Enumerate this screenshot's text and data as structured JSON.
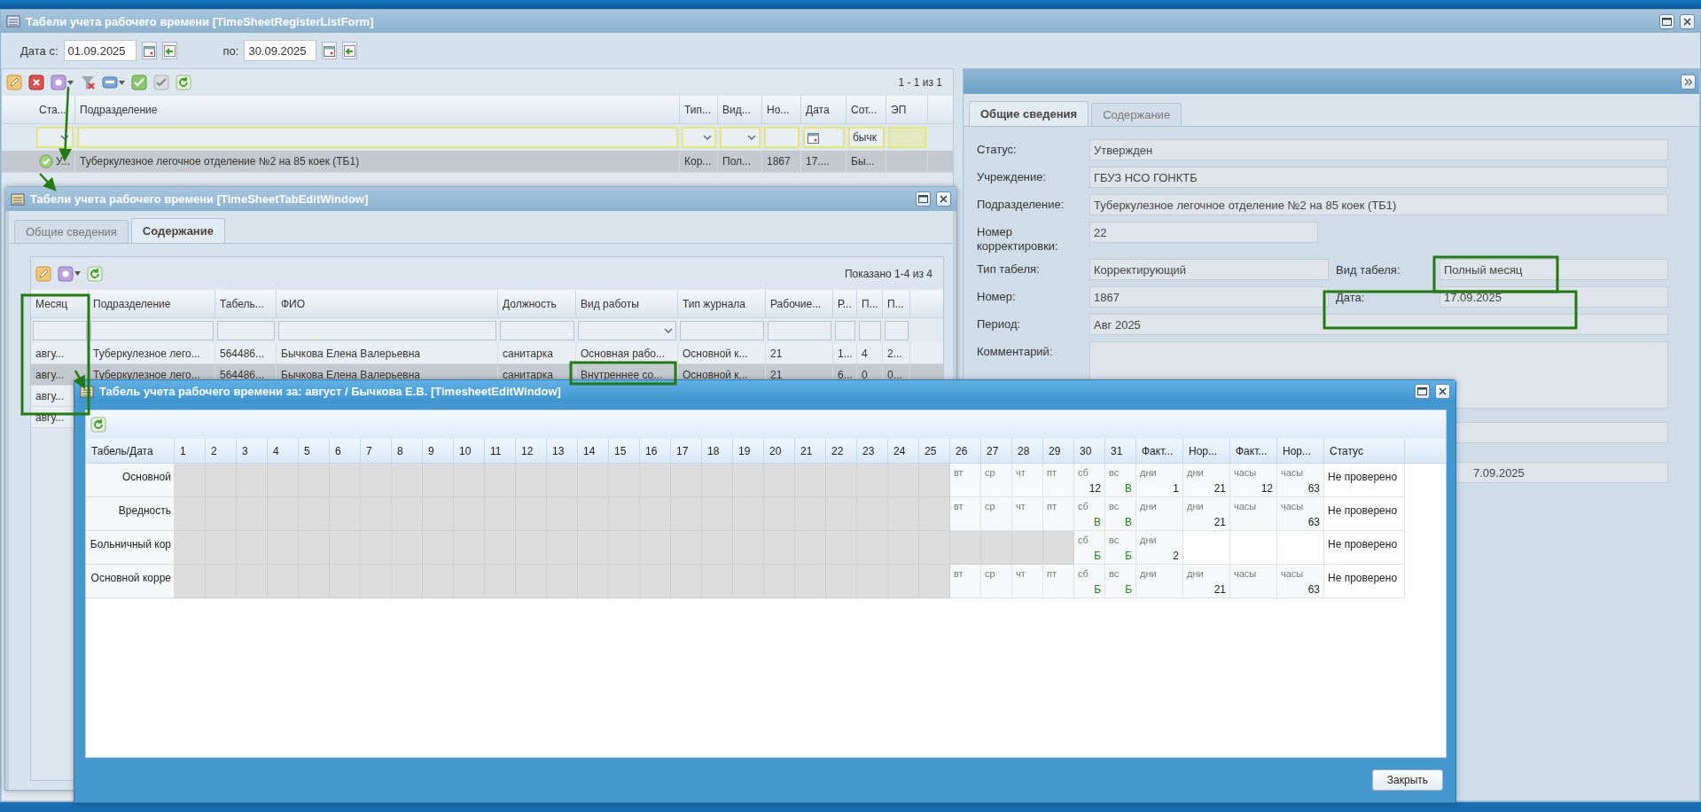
{
  "list_window": {
    "title": "Табели учета рабочего времени [TimeSheetRegisterListForm]",
    "date_from_label": "Дата с:",
    "date_from": "01.09.2025",
    "date_to_label": "по:",
    "date_to": "30.09.2025",
    "pager": "1 - 1 из 1",
    "columns": [
      "Ста...",
      "Подразделение",
      "Тип...",
      "Вид...",
      "Но...",
      "Дата",
      "Сот...",
      "ЭП"
    ],
    "filters": [
      {
        "kind": "select"
      },
      {
        "kind": "text"
      },
      {
        "kind": "select"
      },
      {
        "kind": "select"
      },
      {
        "kind": "text"
      },
      {
        "kind": "date"
      },
      {
        "kind": "text",
        "value": "бычк"
      },
      {
        "kind": "flag"
      }
    ],
    "rows": [
      {
        "selected": true,
        "cells": [
          "У...",
          "Туберкулезное легочное отделение №2 на 85 коек (ТБ1)",
          "Кор...",
          "Пол...",
          "1867",
          "17....",
          "Бы...",
          ""
        ]
      }
    ]
  },
  "detail_panel": {
    "tabs": [
      {
        "label": "Общие сведения",
        "selected": true
      },
      {
        "label": "Содержание",
        "selected": false
      }
    ],
    "fields": [
      {
        "kind": "single",
        "label": "Статус:",
        "value": "Утвержден"
      },
      {
        "kind": "single",
        "label": "Учреждение:",
        "value": "ГБУЗ НСО ГОНКТБ"
      },
      {
        "kind": "single",
        "label": "Подразделение:",
        "value": "Туберкулезное легочное отделение №2 на 85 коек (ТБ1)"
      },
      {
        "kind": "short",
        "label": "Номер корректировки:",
        "value": "22"
      },
      {
        "kind": "pair",
        "label": "Тип табеля:",
        "value": "Корректирующий",
        "side_label": "Вид табеля:",
        "side_value": "Полный месяц"
      },
      {
        "kind": "pair",
        "label": "Номер:",
        "value": "1867",
        "side_label": "Дата:",
        "side_value": "17.09.2025"
      },
      {
        "kind": "single",
        "label": "Период:",
        "value": "Авг 2025"
      },
      {
        "kind": "area",
        "label": "Комментарий:"
      },
      {
        "kind": "covered"
      },
      {
        "kind": "covered",
        "value": "7.09.2025"
      }
    ]
  },
  "tab_window": {
    "title": "Табели учета рабочего времени [TimeSheetTabEditWindow]",
    "tabs": [
      {
        "label": "Общие сведения",
        "selected": false
      },
      {
        "label": "Содержание",
        "selected": true
      }
    ],
    "pager": "Показано 1-4 из 4",
    "columns": [
      "Месяц",
      "Подразделение",
      "Табель...",
      "ФИО",
      "Должность",
      "Вид работы",
      "Тип журнала",
      "Рабочие...",
      "Р...",
      "П...",
      "П..."
    ],
    "filters": [
      {
        "kind": "text"
      },
      {
        "kind": "text"
      },
      {
        "kind": "text"
      },
      {
        "kind": "text"
      },
      {
        "kind": "text"
      },
      {
        "kind": "select"
      },
      {
        "kind": "text"
      },
      {
        "kind": "text"
      },
      {
        "kind": "text"
      },
      {
        "kind": "text"
      },
      {
        "kind": "text"
      }
    ],
    "rows": [
      {
        "selected": false,
        "cells": [
          "авгу...",
          "Туберкулезное лего...",
          "564486...",
          "Бычкова Елена Валерьевна",
          "санитарка",
          "Основная рабо...",
          "Основной к...",
          "21",
          "1...",
          "4",
          "2..."
        ]
      },
      {
        "selected": true,
        "cells": [
          "авгу...",
          "Туберкулезное лего...",
          "564486...",
          "Бычкова Елена Валерьевна",
          "санитарка",
          "Внутреннее со...",
          "Основной к...",
          "21",
          "6...",
          "0",
          "0..."
        ]
      },
      {
        "selected": false,
        "cells": [
          "авгу..."
        ]
      },
      {
        "selected": false,
        "cells": [
          "авгу..."
        ]
      }
    ]
  },
  "sheet_window": {
    "title": "Табель учета рабочего времени за: август / Бычкова Е.В. [TimesheetEditWindow]",
    "close_button": "Закрыть",
    "columns": [
      "Табель/Дата",
      "1",
      "2",
      "3",
      "4",
      "5",
      "6",
      "7",
      "8",
      "9",
      "10",
      "11",
      "12",
      "13",
      "14",
      "15",
      "16",
      "17",
      "18",
      "19",
      "20",
      "21",
      "22",
      "23",
      "24",
      "25",
      "26",
      "27",
      "28",
      "29",
      "30",
      "31",
      "Факт...",
      "Нор...",
      "Факт...",
      "Нор...",
      "Статус"
    ],
    "rows": [
      {
        "label": "Основной",
        "status": "Не проверено",
        "days": [
          {
            "kind": "blank"
          },
          {
            "kind": "blank"
          },
          {
            "kind": "blank"
          },
          {
            "kind": "blank"
          },
          {
            "kind": "blank"
          },
          {
            "kind": "blank"
          },
          {
            "kind": "blank"
          },
          {
            "kind": "blank"
          },
          {
            "kind": "blank"
          },
          {
            "kind": "blank"
          },
          {
            "kind": "blank"
          },
          {
            "kind": "blank"
          },
          {
            "kind": "blank"
          },
          {
            "kind": "blank"
          },
          {
            "kind": "blank"
          },
          {
            "kind": "blank"
          },
          {
            "kind": "blank"
          },
          {
            "kind": "blank"
          },
          {
            "kind": "blank"
          },
          {
            "kind": "blank"
          },
          {
            "kind": "blank"
          },
          {
            "kind": "blank"
          },
          {
            "kind": "blank"
          },
          {
            "kind": "blank"
          },
          {
            "kind": "blank"
          },
          {
            "kind": "day",
            "weekday": "вт"
          },
          {
            "kind": "day",
            "weekday": "ср"
          },
          {
            "kind": "day",
            "weekday": "чт"
          },
          {
            "kind": "day",
            "weekday": "пт"
          },
          {
            "kind": "day",
            "weekday": "сб",
            "value": "12"
          },
          {
            "kind": "code",
            "weekday": "вс",
            "value": "В"
          }
        ],
        "totals": [
          {
            "kind": "total",
            "unit": "дни",
            "value": "1"
          },
          {
            "kind": "total",
            "unit": "дни",
            "value": "21"
          },
          {
            "kind": "total",
            "unit": "часы",
            "value": "12"
          },
          {
            "kind": "total",
            "unit": "часы",
            "value": "63"
          }
        ]
      },
      {
        "label": "Вредность",
        "status": "Не проверено",
        "days": [
          {
            "kind": "blank"
          },
          {
            "kind": "blank"
          },
          {
            "kind": "blank"
          },
          {
            "kind": "blank"
          },
          {
            "kind": "blank"
          },
          {
            "kind": "blank"
          },
          {
            "kind": "blank"
          },
          {
            "kind": "blank"
          },
          {
            "kind": "blank"
          },
          {
            "kind": "blank"
          },
          {
            "kind": "blank"
          },
          {
            "kind": "blank"
          },
          {
            "kind": "blank"
          },
          {
            "kind": "blank"
          },
          {
            "kind": "blank"
          },
          {
            "kind": "blank"
          },
          {
            "kind": "blank"
          },
          {
            "kind": "blank"
          },
          {
            "kind": "blank"
          },
          {
            "kind": "blank"
          },
          {
            "kind": "blank"
          },
          {
            "kind": "blank"
          },
          {
            "kind": "blank"
          },
          {
            "kind": "blank"
          },
          {
            "kind": "blank"
          },
          {
            "kind": "day",
            "weekday": "вт"
          },
          {
            "kind": "day",
            "weekday": "ср"
          },
          {
            "kind": "day",
            "weekday": "чт"
          },
          {
            "kind": "day",
            "weekday": "пт"
          },
          {
            "kind": "code",
            "weekday": "сб",
            "value": "В"
          },
          {
            "kind": "code",
            "weekday": "вс",
            "value": "В"
          }
        ],
        "totals": [
          {
            "kind": "total",
            "unit": "дни"
          },
          {
            "kind": "total",
            "unit": "дни",
            "value": "21"
          },
          {
            "kind": "total",
            "unit": "часы"
          },
          {
            "kind": "total",
            "unit": "часы",
            "value": "63"
          }
        ]
      },
      {
        "label": "Больничный кор",
        "status": "Не проверено",
        "days": [
          {
            "kind": "blank"
          },
          {
            "kind": "blank"
          },
          {
            "kind": "blank"
          },
          {
            "kind": "blank"
          },
          {
            "kind": "blank"
          },
          {
            "kind": "blank"
          },
          {
            "kind": "blank"
          },
          {
            "kind": "blank"
          },
          {
            "kind": "blank"
          },
          {
            "kind": "blank"
          },
          {
            "kind": "blank"
          },
          {
            "kind": "blank"
          },
          {
            "kind": "blank"
          },
          {
            "kind": "blank"
          },
          {
            "kind": "blank"
          },
          {
            "kind": "blank"
          },
          {
            "kind": "blank"
          },
          {
            "kind": "blank"
          },
          {
            "kind": "blank"
          },
          {
            "kind": "blank"
          },
          {
            "kind": "blank"
          },
          {
            "kind": "blank"
          },
          {
            "kind": "blank"
          },
          {
            "kind": "blank"
          },
          {
            "kind": "blank"
          },
          {
            "kind": "blank"
          },
          {
            "kind": "blank"
          },
          {
            "kind": "blank"
          },
          {
            "kind": "blank"
          },
          {
            "kind": "code",
            "weekday": "сб",
            "value": "Б"
          },
          {
            "kind": "code",
            "weekday": "вс",
            "value": "Б"
          }
        ],
        "totals": [
          {
            "kind": "total",
            "unit": "дни",
            "value": "2"
          },
          {
            "kind": "empty"
          },
          {
            "kind": "empty"
          },
          {
            "kind": "empty"
          }
        ]
      },
      {
        "label": "Основной корре",
        "status": "Не проверено",
        "days": [
          {
            "kind": "blank"
          },
          {
            "kind": "blank"
          },
          {
            "kind": "blank"
          },
          {
            "kind": "blank"
          },
          {
            "kind": "blank"
          },
          {
            "kind": "blank"
          },
          {
            "kind": "blank"
          },
          {
            "kind": "blank"
          },
          {
            "kind": "blank"
          },
          {
            "kind": "blank"
          },
          {
            "kind": "blank"
          },
          {
            "kind": "blank"
          },
          {
            "kind": "blank"
          },
          {
            "kind": "blank"
          },
          {
            "kind": "blank"
          },
          {
            "kind": "blank"
          },
          {
            "kind": "blank"
          },
          {
            "kind": "blank"
          },
          {
            "kind": "blank"
          },
          {
            "kind": "blank"
          },
          {
            "kind": "blank"
          },
          {
            "kind": "blank"
          },
          {
            "kind": "blank"
          },
          {
            "kind": "blank"
          },
          {
            "kind": "blank"
          },
          {
            "kind": "day",
            "weekday": "вт"
          },
          {
            "kind": "day",
            "weekday": "ср"
          },
          {
            "kind": "day",
            "weekday": "чт"
          },
          {
            "kind": "day",
            "weekday": "пт"
          },
          {
            "kind": "code",
            "weekday": "сб",
            "value": "Б"
          },
          {
            "kind": "code",
            "weekday": "вс",
            "value": "Б"
          }
        ],
        "totals": [
          {
            "kind": "total",
            "unit": "дни"
          },
          {
            "kind": "total",
            "unit": "дни",
            "value": "21"
          },
          {
            "kind": "total",
            "unit": "часы"
          },
          {
            "kind": "total",
            "unit": "часы",
            "value": "63"
          }
        ]
      }
    ]
  }
}
